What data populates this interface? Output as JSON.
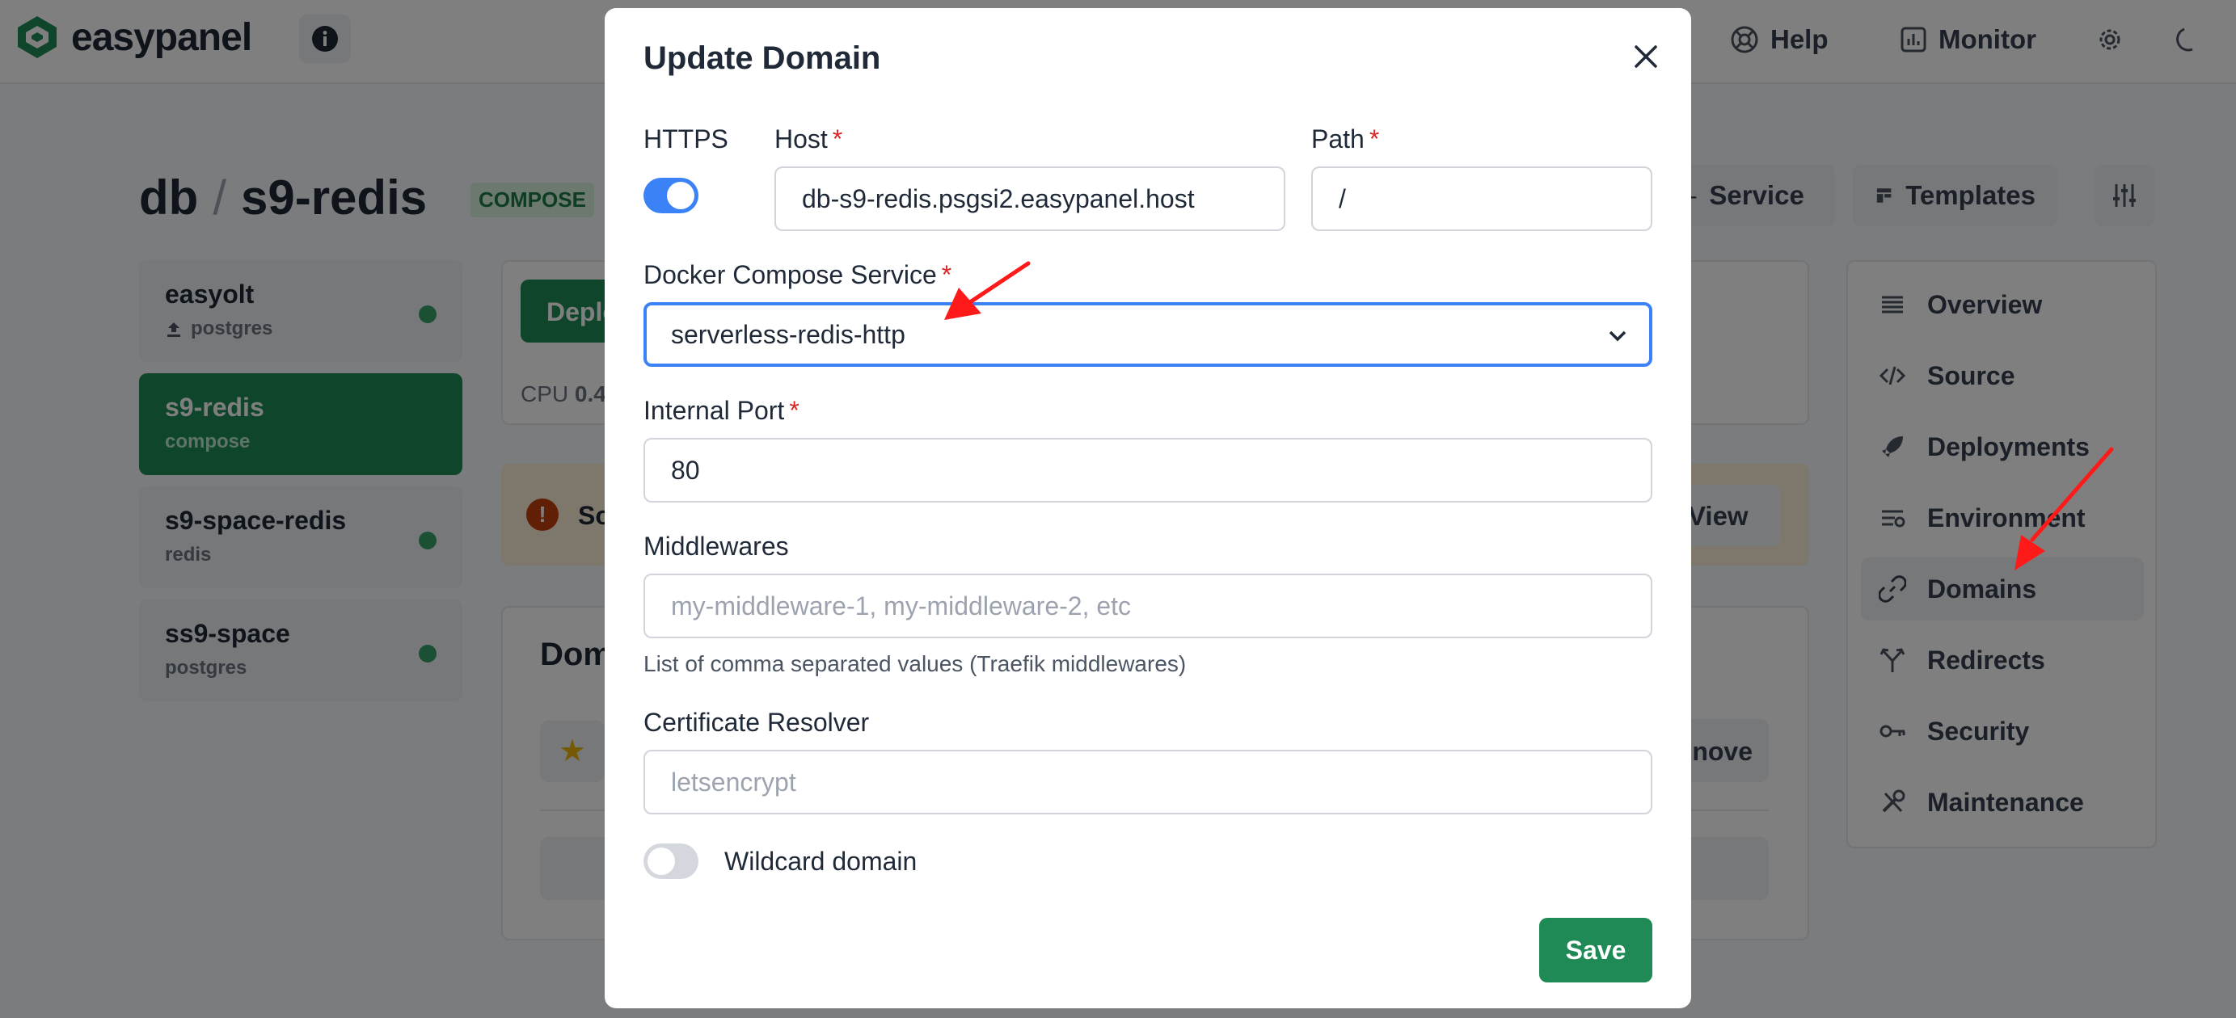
{
  "header": {
    "logo_text": "easypanel",
    "help_label": "Help",
    "monitor_label": "Monitor"
  },
  "page": {
    "project": "db",
    "separator": "/",
    "service": "s9-redis",
    "badge": "COMPOSE",
    "service_button": "Service",
    "templates_button": "Templates"
  },
  "sidebar": {
    "items": [
      {
        "name": "easyolt",
        "type": "postgres"
      },
      {
        "name": "s9-redis",
        "type": "compose"
      },
      {
        "name": "s9-space-redis",
        "type": "redis"
      },
      {
        "name": "ss9-space",
        "type": "postgres"
      }
    ]
  },
  "main": {
    "deploy_button": "Deploy",
    "cpu_label": "CPU",
    "cpu_value": "0.4",
    "warning_text": "So",
    "view_button": "View",
    "domains_title": "Dom",
    "remove_button": "nove"
  },
  "right_nav": {
    "items": [
      {
        "label": "Overview",
        "icon": "list-icon"
      },
      {
        "label": "Source",
        "icon": "code-icon"
      },
      {
        "label": "Deployments",
        "icon": "rocket-icon"
      },
      {
        "label": "Environment",
        "icon": "sliders-icon"
      },
      {
        "label": "Domains",
        "icon": "link-icon"
      },
      {
        "label": "Redirects",
        "icon": "fork-icon"
      },
      {
        "label": "Security",
        "icon": "key-icon"
      },
      {
        "label": "Maintenance",
        "icon": "tools-icon"
      }
    ],
    "active": "Domains"
  },
  "modal": {
    "title": "Update Domain",
    "https_label": "HTTPS",
    "https_enabled": true,
    "host_label": "Host",
    "host_value": "db-s9-redis.psgsi2.easypanel.host",
    "path_label": "Path",
    "path_value": "/",
    "compose_service_label": "Docker Compose Service",
    "compose_service_value": "serverless-redis-http",
    "internal_port_label": "Internal Port",
    "internal_port_value": "80",
    "middlewares_label": "Middlewares",
    "middlewares_placeholder": "my-middleware-1, my-middleware-2, etc",
    "middlewares_help": "List of comma separated values (Traefik middlewares)",
    "cert_resolver_label": "Certificate Resolver",
    "cert_resolver_placeholder": "letsencrypt",
    "wildcard_label": "Wildcard domain",
    "wildcard_enabled": false,
    "save_button": "Save",
    "required_mark": "*"
  },
  "colors": {
    "brand_green": "#1f8a55",
    "accent_blue": "#3b82f6",
    "required_red": "#dc2626",
    "annotation_red": "#ff1a1a"
  }
}
